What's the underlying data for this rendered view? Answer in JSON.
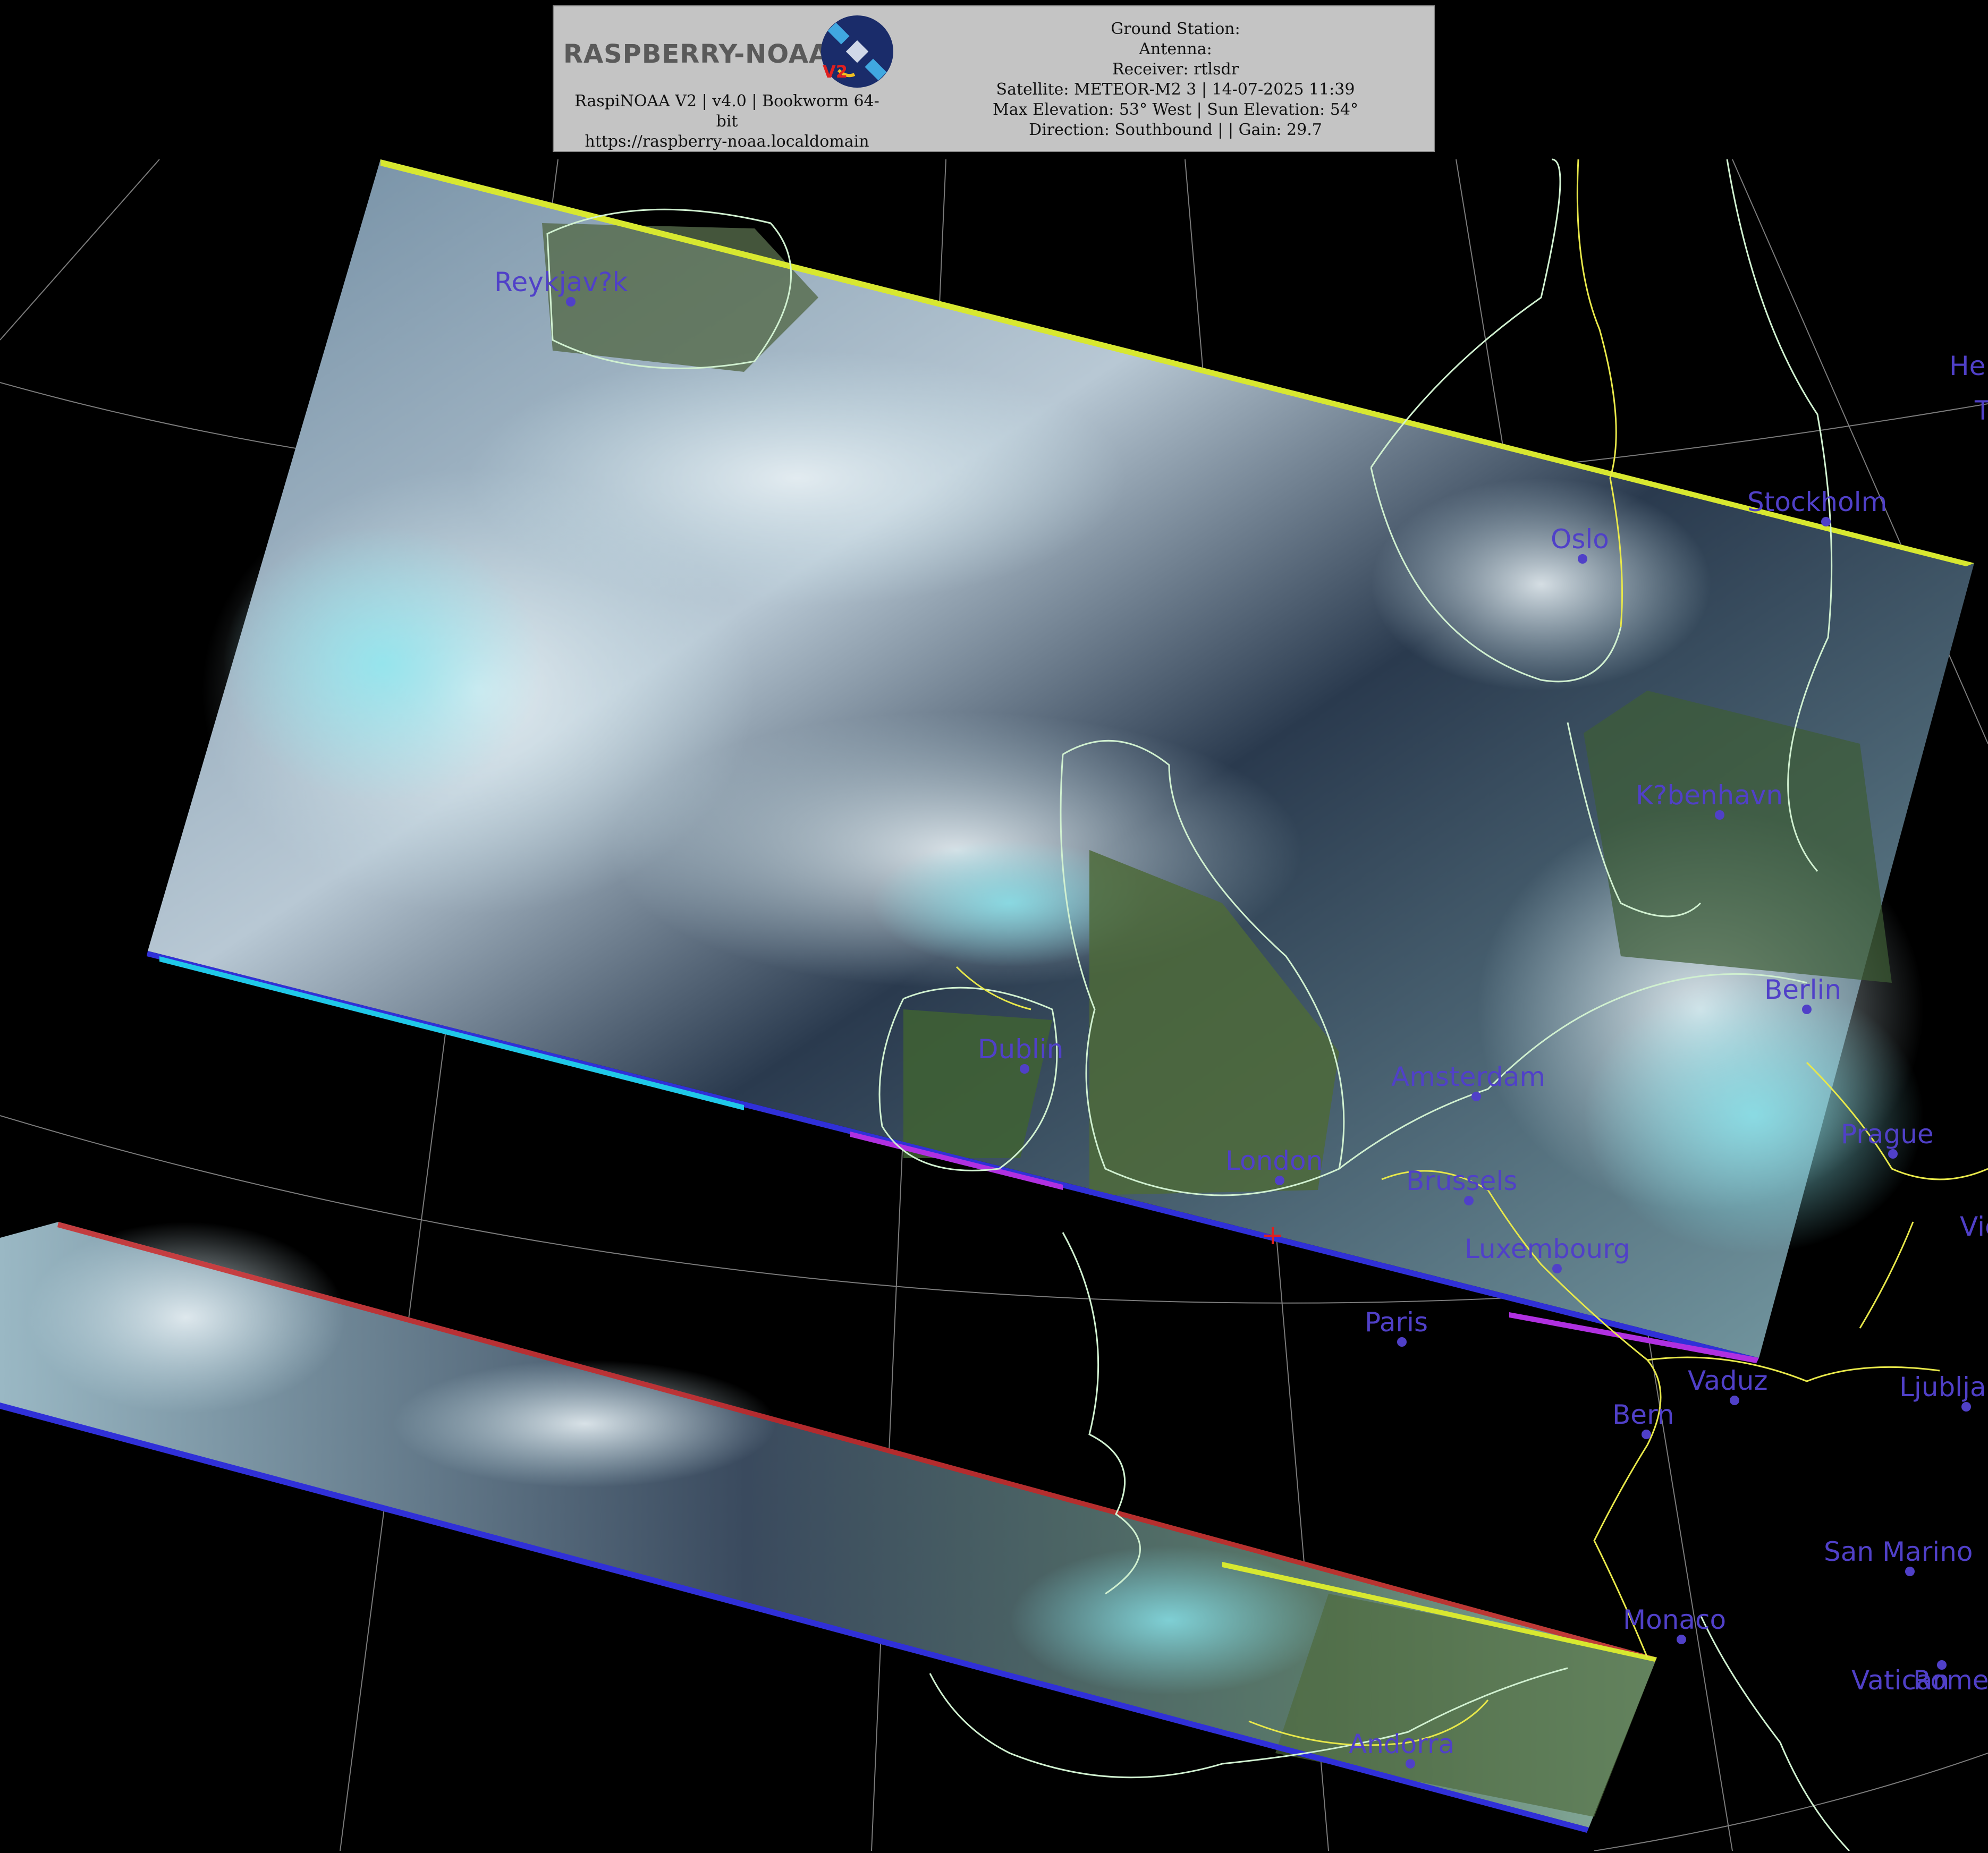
{
  "header": {
    "logo_text": "RASPBERRY-NOAA",
    "logo_badge": "V2",
    "software_line1": "RaspiNOAA V2 | v4.0 | Bookworm 64-",
    "software_line2": "bit",
    "url": "https://raspberry-noaa.localdomain",
    "ground_station": "Ground Station:",
    "antenna": "Antenna:",
    "receiver": "Receiver: rtlsdr",
    "satellite": "Satellite: METEOR-M2 3 | 14-07-2025 11:39",
    "elevation": "Max Elevation: 53° West | Sun Elevation: 54°",
    "direction": "Direction: Southbound | | Gain: 29.7"
  },
  "map": {
    "cities": [
      {
        "key": "reykjavik",
        "label": "Reykjav?k"
      },
      {
        "key": "oslo",
        "label": "Oslo"
      },
      {
        "key": "stockholm",
        "label": "Stockholm"
      },
      {
        "key": "kobenhavn",
        "label": "K?benhavn"
      },
      {
        "key": "berlin",
        "label": "Berlin"
      },
      {
        "key": "dublin",
        "label": "Dublin"
      },
      {
        "key": "amsterdam",
        "label": "Amsterdam"
      },
      {
        "key": "london",
        "label": "London"
      },
      {
        "key": "brussels",
        "label": "Brussels"
      },
      {
        "key": "luxembourg",
        "label": "Luxembourg"
      },
      {
        "key": "prague",
        "label": "Prague"
      },
      {
        "key": "paris",
        "label": "Paris"
      },
      {
        "key": "vaduz",
        "label": "Vaduz"
      },
      {
        "key": "bern",
        "label": "Bern"
      },
      {
        "key": "ljubljana",
        "label": "Ljubljana"
      },
      {
        "key": "san_marino",
        "label": "San Marino"
      },
      {
        "key": "monaco",
        "label": "Monaco"
      },
      {
        "key": "vatican",
        "label": "Vatican"
      },
      {
        "key": "rome",
        "label": "Rome"
      },
      {
        "key": "andorra",
        "label": "Andorra"
      },
      {
        "key": "helsinki",
        "label": "Helsinki"
      },
      {
        "key": "tallinn",
        "label": "Tallinn"
      },
      {
        "key": "vienna",
        "label": "Vienna"
      }
    ],
    "colors": {
      "city": "#5040c8",
      "coast": "#d0f0d0",
      "border": "#e8e84a",
      "graticule": "#9a9a9a",
      "station_marker": "#e02020"
    }
  }
}
